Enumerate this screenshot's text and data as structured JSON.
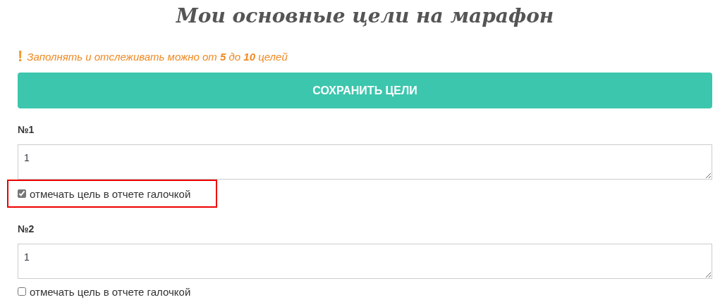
{
  "title": "Мои основные цели на марафон",
  "notice": {
    "icon": "!",
    "text": "Заполнять и отслеживать можно от **5** до **10** целей"
  },
  "save_button": "СОХРАНИТЬ ЦЕЛИ",
  "goals": [
    {
      "label": "№1",
      "value": "1",
      "checkbox_label": "отмечать цель в отчете галочкой",
      "checked": true,
      "highlighted": true
    },
    {
      "label": "№2",
      "value": "1",
      "checkbox_label": "отмечать цель в отчете галочкой",
      "checked": false,
      "highlighted": false
    }
  ]
}
